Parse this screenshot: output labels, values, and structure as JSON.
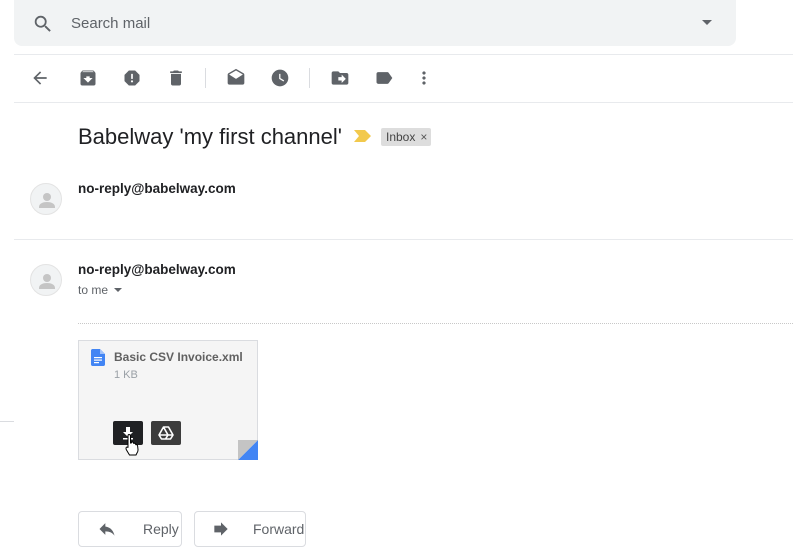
{
  "search": {
    "placeholder": "Search mail"
  },
  "message": {
    "subject": "Babelway 'my first channel'",
    "label": "Inbox",
    "label_remove": "×",
    "first_sender": "no-reply@babelway.com",
    "second_sender": "no-reply@babelway.com",
    "recipient": "to me"
  },
  "attachment": {
    "name": "Basic CSV Invoice.xml",
    "size": "1 KB"
  },
  "actions": {
    "reply": "Reply",
    "forward": "Forward"
  },
  "colors": {
    "importance": "#f2c94c",
    "doc_icon": "#4285f4",
    "fold": "#4285f4"
  }
}
